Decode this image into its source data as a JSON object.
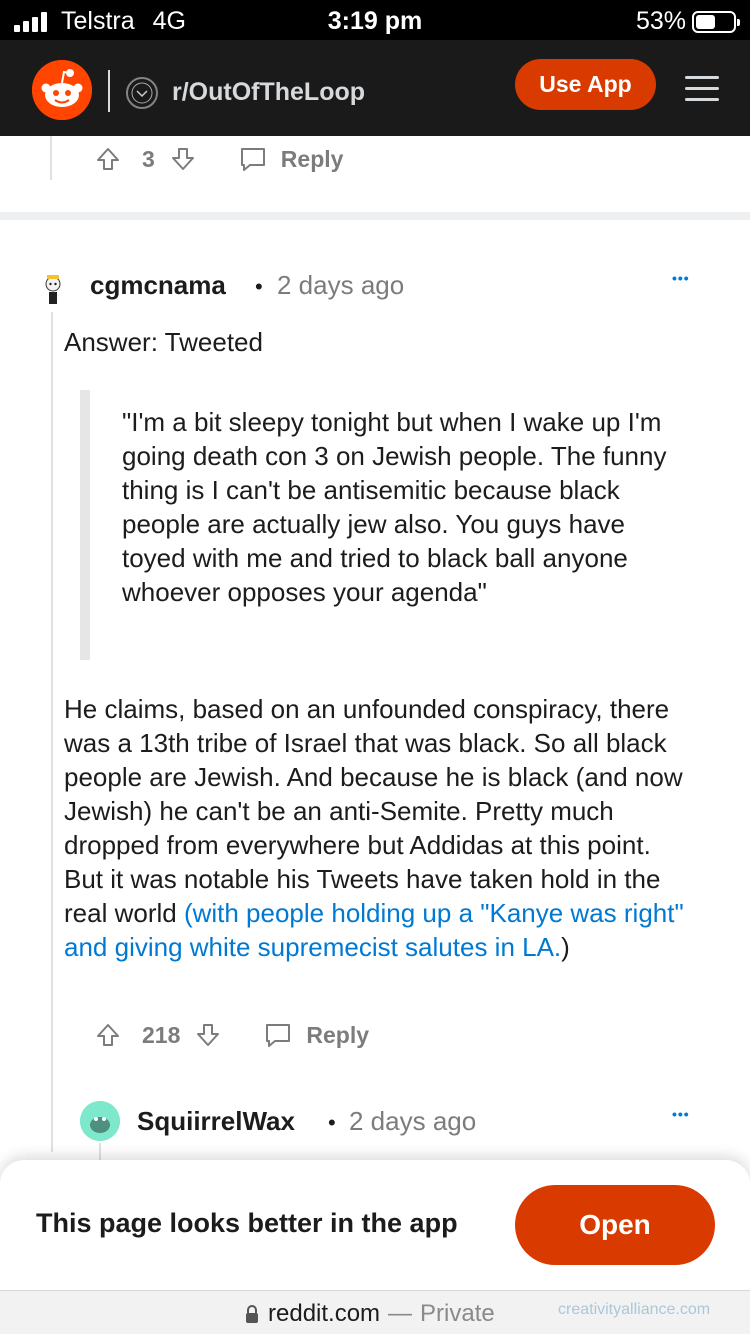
{
  "status_bar": {
    "carrier": "Telstra",
    "network": "4G",
    "time": "3:19 pm",
    "battery": "53%",
    "battery_level": 0.53
  },
  "header": {
    "subreddit": "r/OutOfTheLoop",
    "use_app_label": "Use App",
    "colors": {
      "background": "#1a1a1b",
      "accent": "#ff4500",
      "button": "#d93a00"
    }
  },
  "prev_comment": {
    "votes": "3",
    "reply_label": "Reply"
  },
  "comment": {
    "username": "cgmcnama",
    "separator": "•",
    "time_ago": "2 days ago",
    "more": "•••",
    "title": "Answer: Tweeted",
    "quote": "\"I'm a bit sleepy tonight but when I wake up I'm going death con 3 on Jewish people. The funny thing is I can't be antisemitic because black people are actually jew also. You guys have toyed with me and tried to black ball anyone whoever opposes your agenda\"",
    "body": "He claims, based on an unfounded conspiracy, there was a 13th tribe of Israel that was black. So all black people are Jewish. And because he is black (and now Jewish) he can't be an anti-Semite. Pretty much dropped from everywhere but Addidas at this point. But it was notable his Tweets have taken hold in the real world ",
    "link_text": "(with people holding up a \"Kanye was right\" and giving white supremecist salutes in LA.",
    "body_end": ")",
    "votes": "218",
    "reply_label": "Reply"
  },
  "reply": {
    "username": "SquiirrelWax",
    "separator": "•",
    "time_ago": "2 days ago",
    "more": "•••"
  },
  "bottom_sheet": {
    "message": "This page looks better in the app",
    "open_label": "Open"
  },
  "url_bar": {
    "domain": "reddit.com",
    "dash": "—",
    "mode": "Private",
    "watermark": "creativityalliance.com"
  }
}
